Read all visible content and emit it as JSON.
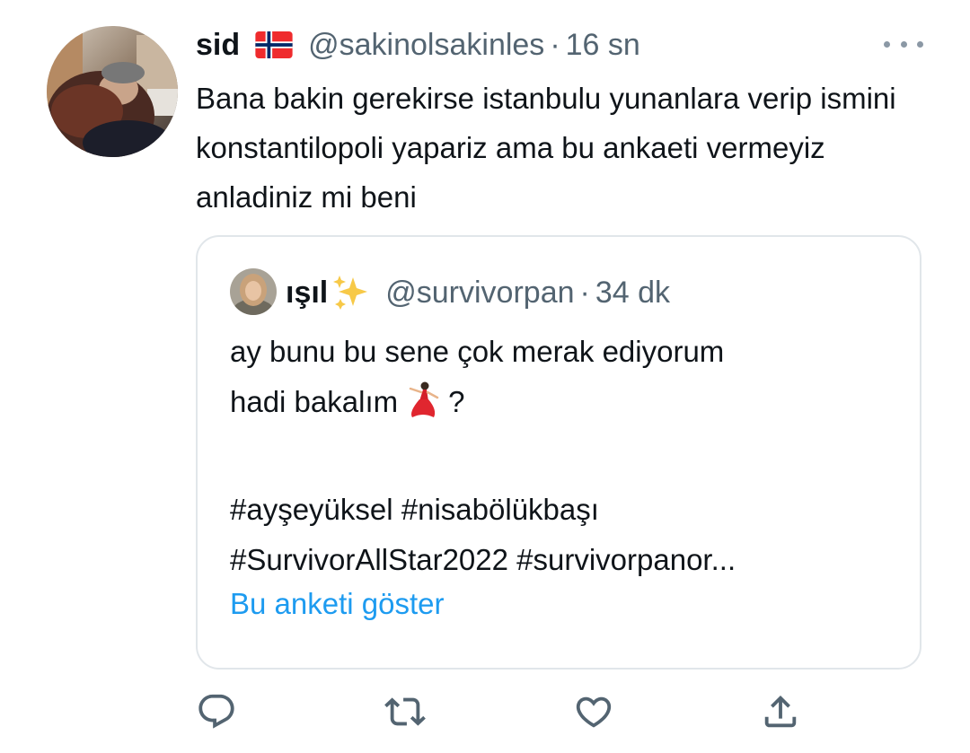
{
  "tweet": {
    "display_name": "sid",
    "flag_icon": "norway-flag-icon",
    "handle": "@sakinolsakinles",
    "separator": "·",
    "time": "16 sn",
    "text": "Bana bakin gerekirse istanbulu yunanlara verip ismini konstantilopoli yapariz ama bu ankaeti vermeyiz anladiniz mi beni",
    "more_icon": "more-icon"
  },
  "quoted": {
    "display_name": "ışıl",
    "sparkle_icon": "sparkles-icon",
    "handle": "@survivorpan",
    "separator": "·",
    "time": "34 dk",
    "line1": "ay bunu bu sene çok merak ediyorum",
    "line2_before": "hadi bakalım",
    "line2_emoji": "dancer-icon",
    "line2_after": "?",
    "hashtags_line1": "#ayşeyüksel #nisabölükbaşı",
    "hashtags_line2": "#SurvivorAllStar2022 #survivorpanor...",
    "show_poll": "Bu anketi göster"
  },
  "actions": {
    "reply_icon": "reply-icon",
    "retweet_icon": "retweet-icon",
    "like_icon": "like-icon",
    "share_icon": "share-icon"
  },
  "colors": {
    "text": "#0f1419",
    "secondary": "#536471",
    "link": "#1d9bf0",
    "border": "#e1e6ea"
  }
}
